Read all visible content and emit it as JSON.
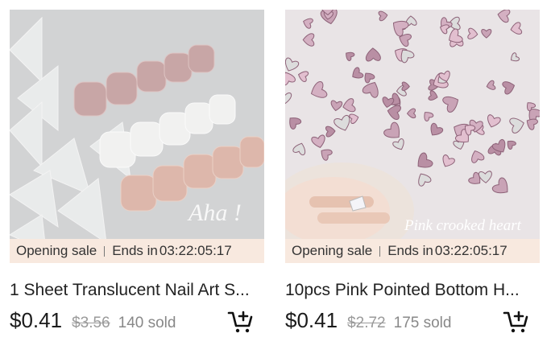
{
  "products": [
    {
      "title": "1 Sheet Translucent Nail Art S...",
      "price": "$0.41",
      "original_price": "$3.56",
      "sold": "140 sold",
      "sale_label": "Opening sale",
      "ends_label": "Ends in",
      "countdown": "03:22:05:17",
      "image_watermark": "Aha !"
    },
    {
      "title": "10pcs Pink Pointed Bottom H...",
      "price": "$0.41",
      "original_price": "$2.72",
      "sold": "175 sold",
      "sale_label": "Opening sale",
      "ends_label": "Ends in",
      "countdown": "03:22:05:17",
      "image_watermark": "Pink crooked heart"
    }
  ],
  "colors": {
    "sale_bar_bg": "#f8e9df",
    "price": "#1b1b1b",
    "original_price": "#9a9a9a",
    "sold": "#888888"
  },
  "icons": {
    "cart": "add-to-cart-icon"
  }
}
